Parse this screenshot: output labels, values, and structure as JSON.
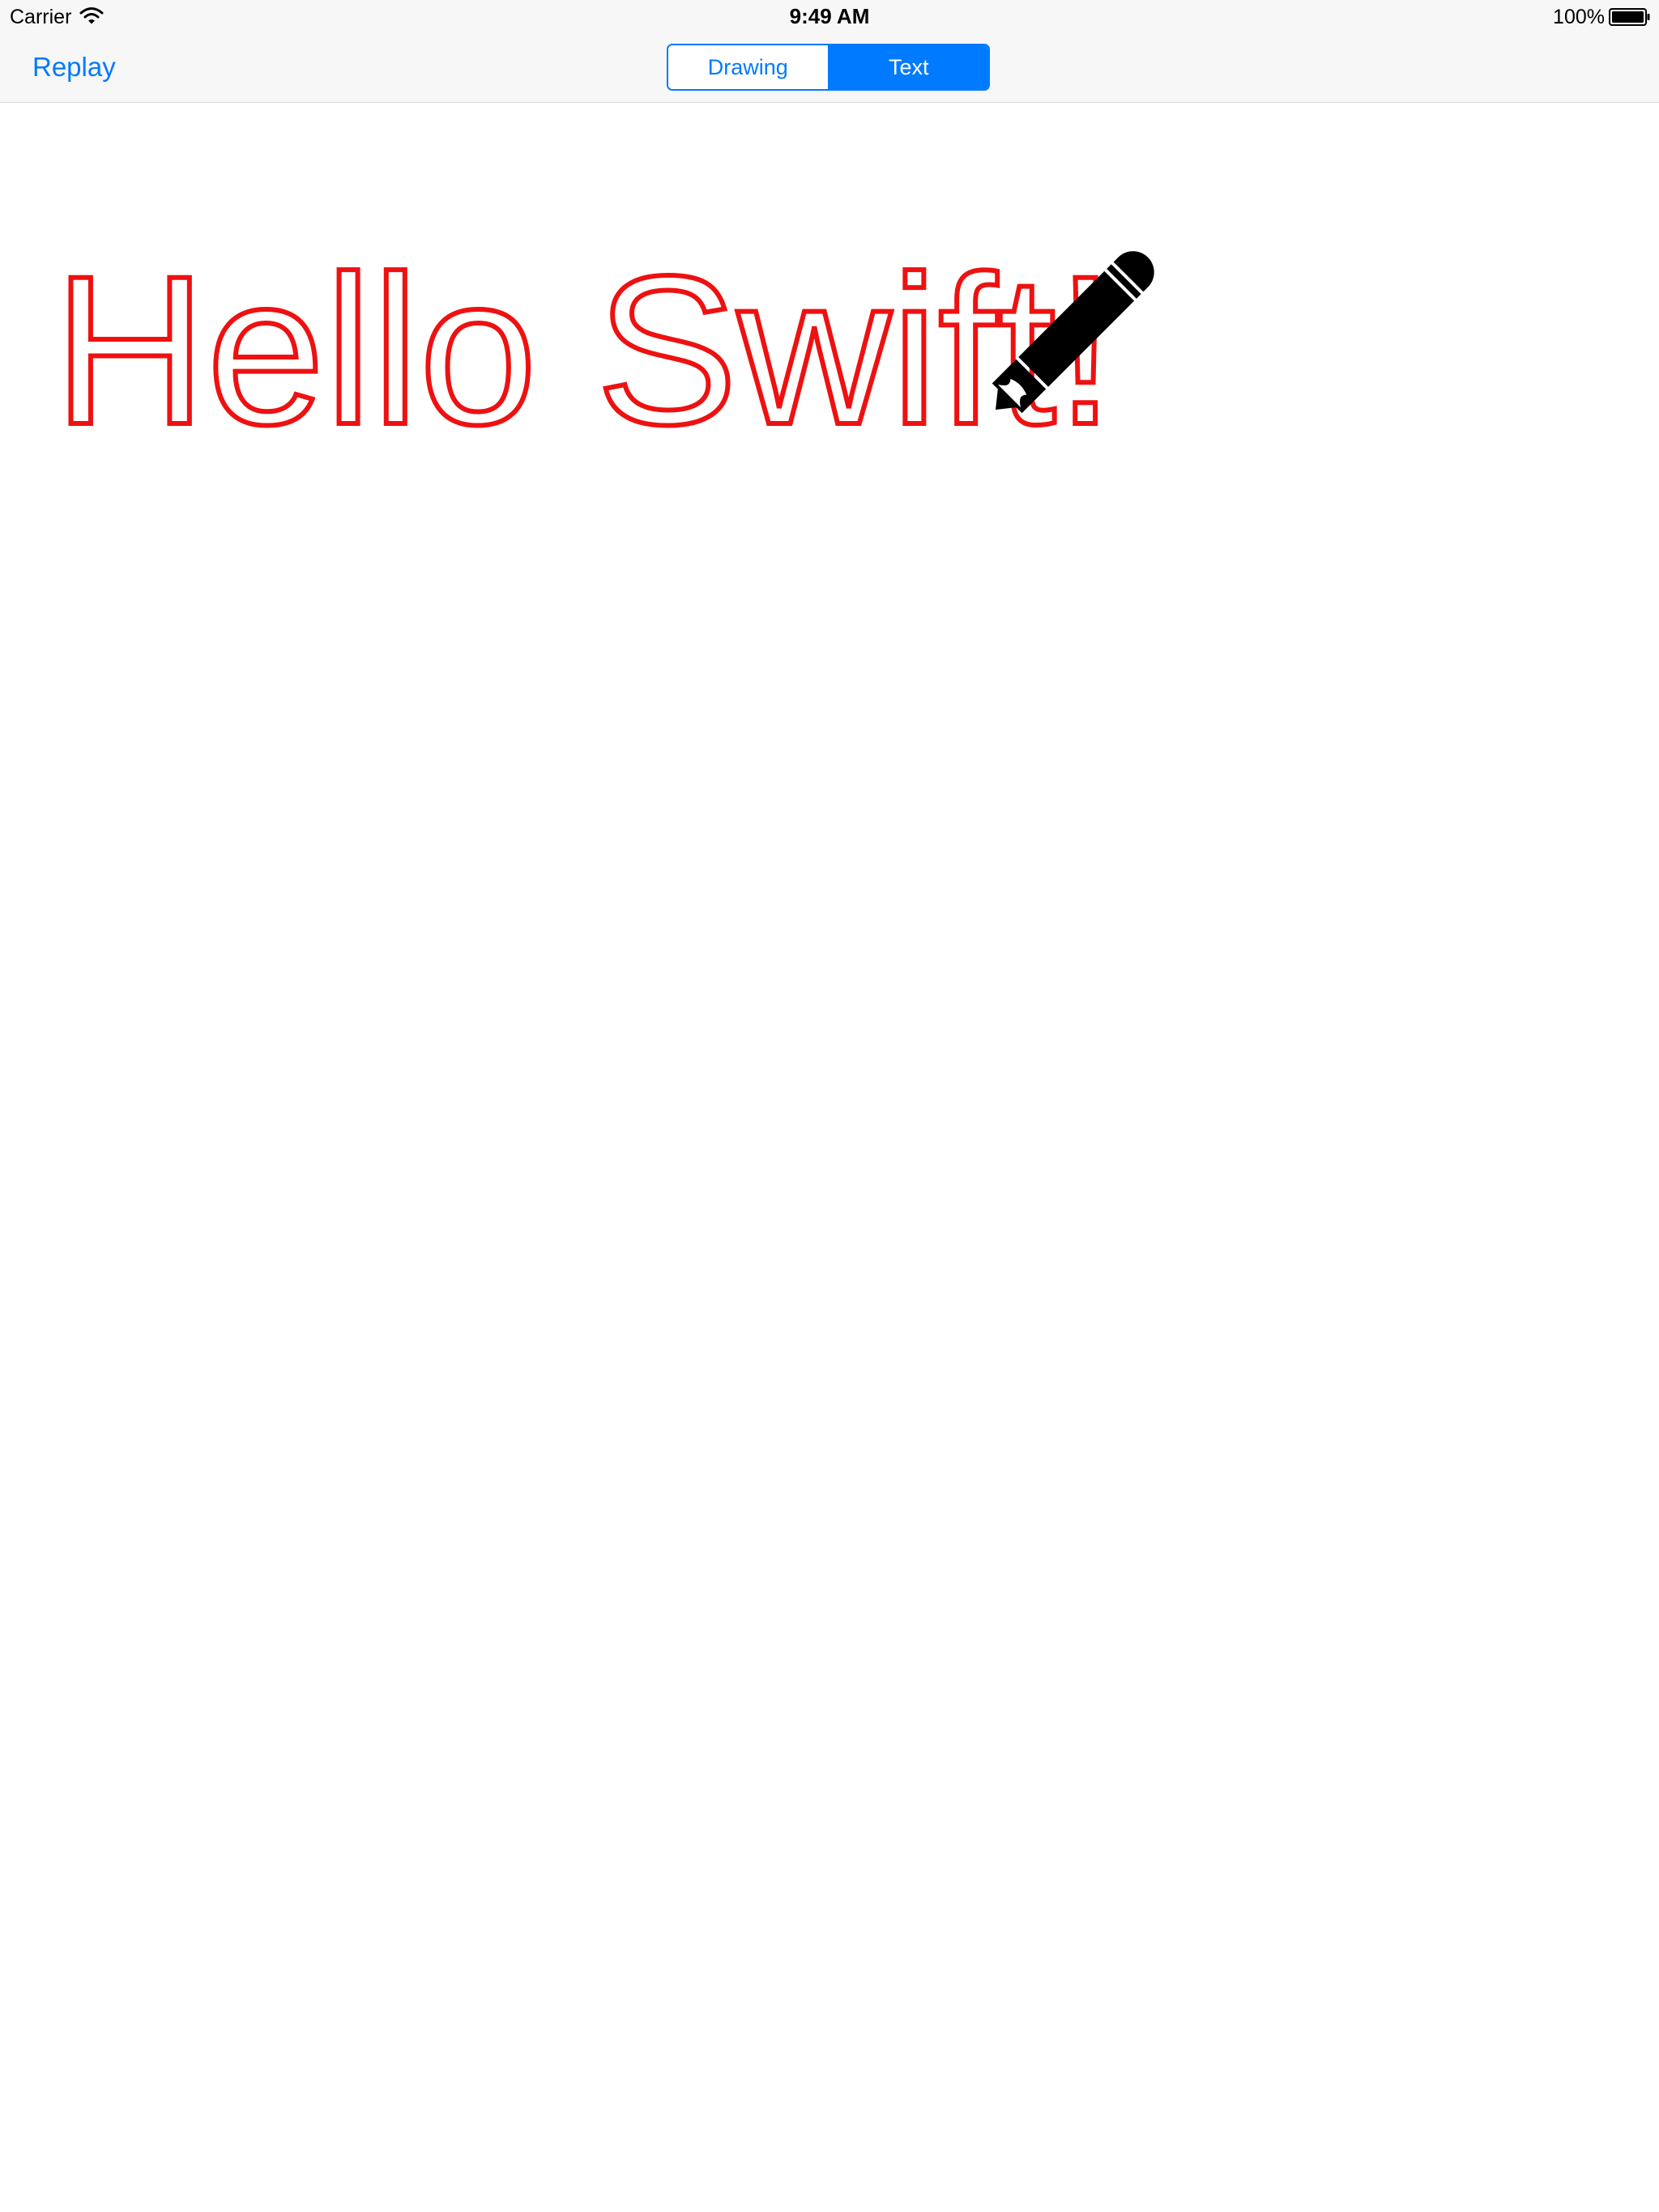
{
  "status_bar": {
    "carrier": "Carrier",
    "time": "9:49 AM",
    "battery_percent": "100%",
    "wifi_icon": "wifi-icon",
    "battery_icon": "battery-icon"
  },
  "nav_bar": {
    "replay_label": "Replay",
    "segments": [
      {
        "label": "Drawing",
        "selected": false
      },
      {
        "label": "Text",
        "selected": true
      }
    ]
  },
  "canvas": {
    "text": "Hello Swift!",
    "text_stroke_color": "#ee1111",
    "pen_icon": "pencil-icon",
    "pen_color": "#000000"
  },
  "accent_color": "#007aff"
}
